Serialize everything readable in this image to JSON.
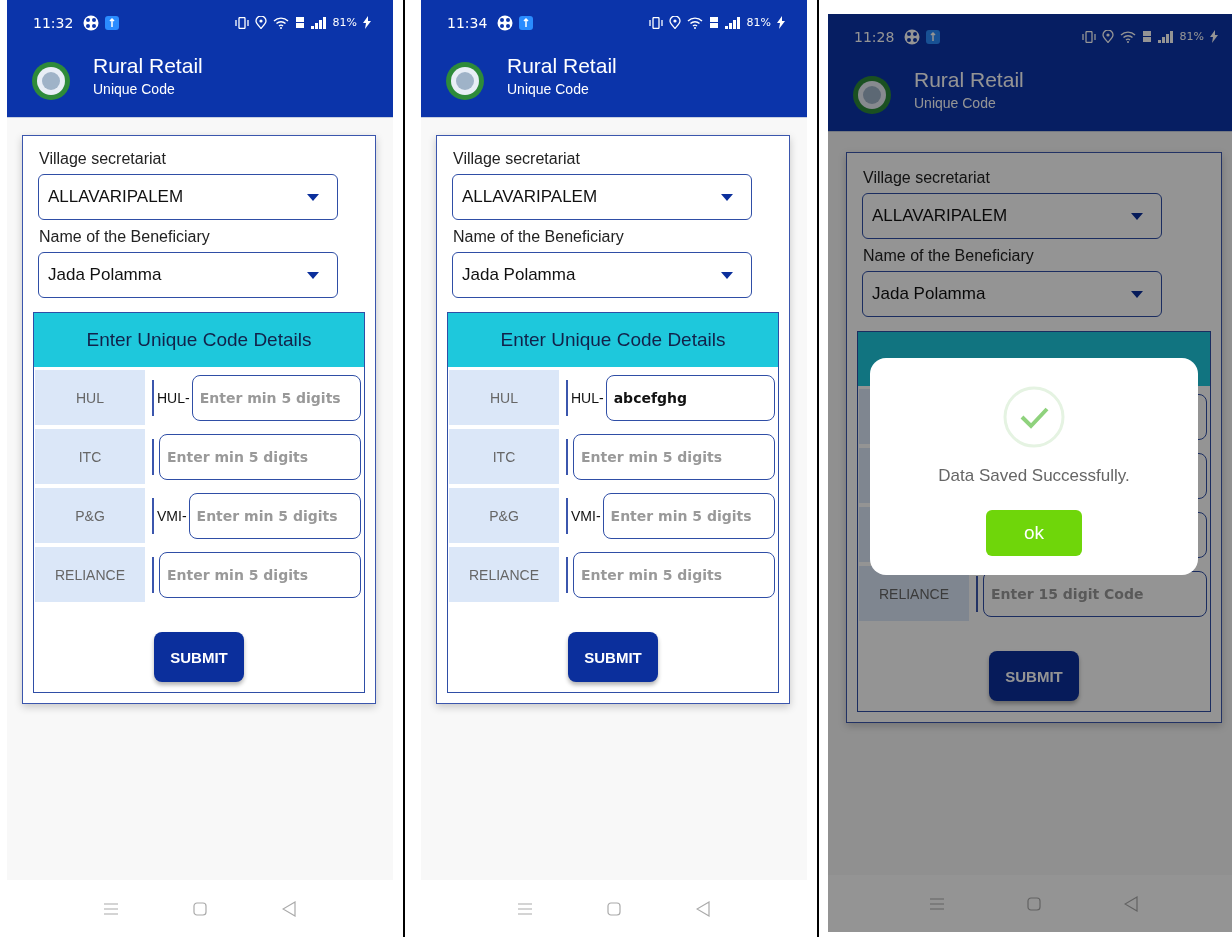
{
  "phones": [
    {
      "status": {
        "time": "11:32",
        "battery": "81%"
      },
      "app": {
        "title": "Rural Retail",
        "subtitle": "Unique Code"
      },
      "form": {
        "fields": [
          {
            "label": "Village secretariat",
            "value": "ALLAVARIPALEM"
          },
          {
            "label": "Name of the Beneficiary",
            "value": "Jada Polamma"
          }
        ],
        "section_title": "Enter Unique Code Details",
        "rows": [
          {
            "kind": "field",
            "label": "HUL",
            "prefix": "HUL-",
            "placeholder": "Enter min 5 digits"
          },
          {
            "kind": "field",
            "label": "ITC",
            "placeholder": "Enter min 5 digits"
          },
          {
            "kind": "field",
            "label": "P&G",
            "prefix": "VMI-",
            "placeholder": "Enter min 5 digits"
          },
          {
            "kind": "field",
            "label": "RELIANCE",
            "placeholder": "Enter min 5 digits"
          }
        ],
        "submit": "SUBMIT"
      }
    },
    {
      "status": {
        "time": "11:34",
        "battery": "81%"
      },
      "app": {
        "title": "Rural Retail",
        "subtitle": "Unique Code"
      },
      "form": {
        "fields": [
          {
            "label": "Village secretariat",
            "value": "ALLAVARIPALEM"
          },
          {
            "label": "Name of the Beneficiary",
            "value": "Jada Polamma"
          }
        ],
        "section_title": "Enter Unique Code Details",
        "rows": [
          {
            "kind": "field",
            "label": "HUL",
            "prefix": "HUL-",
            "value": "abcefghg"
          },
          {
            "kind": "field",
            "label": "ITC",
            "placeholder": "Enter min 5 digits"
          },
          {
            "kind": "field",
            "label": "P&G",
            "prefix": "VMI-",
            "placeholder": "Enter min 5 digits"
          },
          {
            "kind": "field",
            "label": "RELIANCE",
            "placeholder": "Enter min 5 digits"
          }
        ],
        "submit": "SUBMIT"
      }
    },
    {
      "status": {
        "time": "11:28",
        "battery": "81%"
      },
      "app": {
        "title": "Rural Retail",
        "subtitle": "Unique Code"
      },
      "form": {
        "fields": [
          {
            "label": "Village secretariat",
            "value": "ALLAVARIPALEM"
          },
          {
            "label": "Name of the Beneficiary",
            "value": "Jada Polamma"
          }
        ],
        "rows": [
          {
            "kind": "covered"
          },
          {
            "kind": "covered"
          },
          {
            "kind": "covered"
          },
          {
            "kind": "field",
            "label": "RELIANCE",
            "placeholder": "Enter 15 digit Code"
          }
        ],
        "submit": "SUBMIT"
      },
      "dialog": {
        "message": "Data Saved Successfully.",
        "button": "ok"
      }
    }
  ]
}
